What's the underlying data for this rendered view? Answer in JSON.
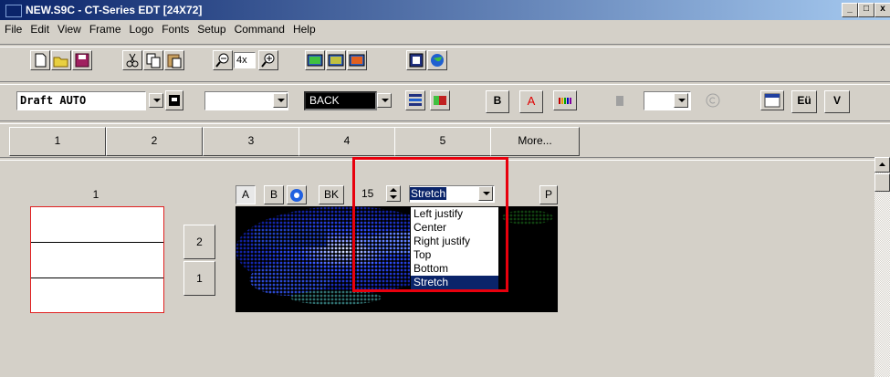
{
  "window": {
    "title": "NEW.S9C - CT-Series EDT  [24X72]",
    "min_label": "_",
    "max_label": "□",
    "close_label": "x"
  },
  "menu": [
    "File",
    "Edit",
    "View",
    "Frame",
    "Logo",
    "Fonts",
    "Setup",
    "Command",
    "Help"
  ],
  "toolbar1": {
    "zoom_value": "4x"
  },
  "toolbar2": {
    "font_value": "Draft AUTO",
    "color_value": "BACK",
    "bold_label": "B",
    "text_color_label": "A",
    "eu_label": "Eü",
    "v_label": "V"
  },
  "frame_tabs": [
    "1",
    "2",
    "3",
    "4",
    "5",
    "More..."
  ],
  "left_panel": {
    "frame_label": "1",
    "line_buttons": [
      "2",
      "1"
    ]
  },
  "preview": {
    "btn_a": "A",
    "btn_b": "B",
    "btn_bk": "BK",
    "spin_value": "15",
    "align_value": "Stretch",
    "btn_p": "P"
  },
  "dropdown": {
    "options": [
      "Left justify",
      "Center",
      "Right justify",
      "Top",
      "Bottom",
      "Stretch"
    ],
    "selected_index": 5
  },
  "colors": {
    "titlebar_start": "#0a246a",
    "titlebar_end": "#a6caf0",
    "highlight": "#e8000d",
    "selection": "#0a246a",
    "frame_border": "#e02020"
  }
}
